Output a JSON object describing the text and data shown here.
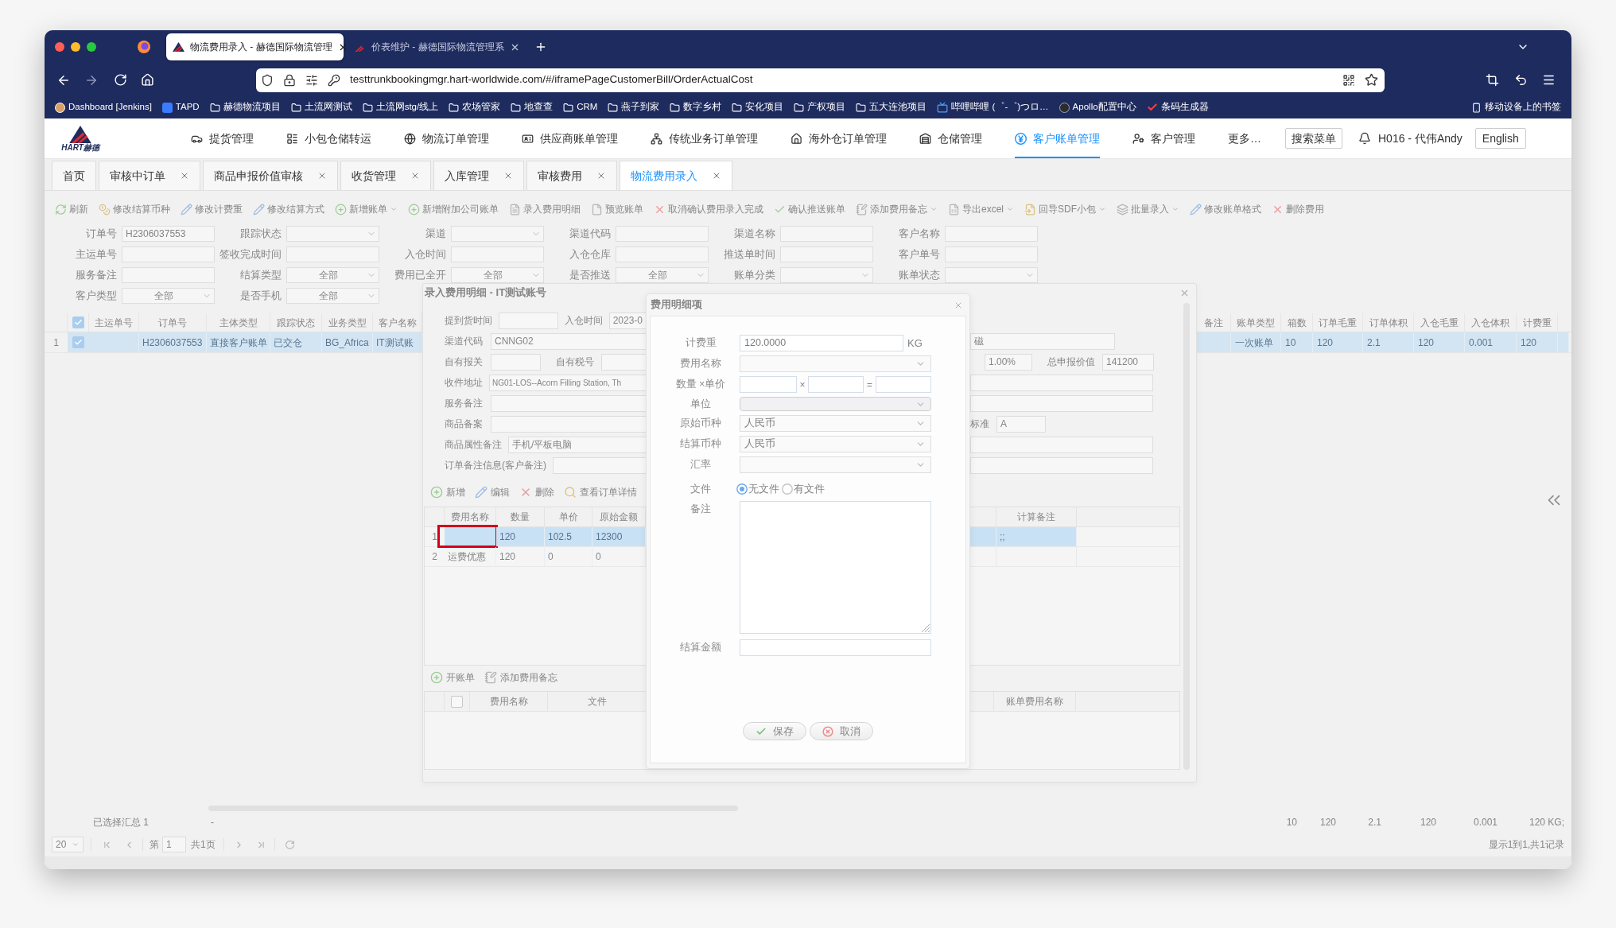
{
  "browser": {
    "tabs": [
      {
        "title": "物流费用录入 - 赫德国际物流管理",
        "selected": true
      },
      {
        "title": "价表维护 - 赫德国际物流管理系",
        "selected": false
      }
    ],
    "url": "testtrunkbookingmgr.hart-worldwide.com/#/iframePageCustomerBill/OrderActualCost",
    "bookmarks": [
      {
        "label": "Dashboard [Jenkins]",
        "kind": "site"
      },
      {
        "label": "TAPD",
        "kind": "site"
      },
      {
        "label": "赫德物流项目",
        "kind": "folder"
      },
      {
        "label": "土流网测试",
        "kind": "folder"
      },
      {
        "label": "土流网stg/线上",
        "kind": "folder"
      },
      {
        "label": "农场管家",
        "kind": "folder"
      },
      {
        "label": "地查查",
        "kind": "folder"
      },
      {
        "label": "CRM",
        "kind": "folder"
      },
      {
        "label": "燕子到家",
        "kind": "folder"
      },
      {
        "label": "数字乡村",
        "kind": "folder"
      },
      {
        "label": "安化项目",
        "kind": "folder"
      },
      {
        "label": "产权项目",
        "kind": "folder"
      },
      {
        "label": "五大连池项目",
        "kind": "folder"
      },
      {
        "label": "哔哩哔哩 (゜-゜)つロ…",
        "kind": "site"
      },
      {
        "label": "Apollo配置中心",
        "kind": "site"
      },
      {
        "label": "条码生成器",
        "kind": "site"
      }
    ],
    "mobile_bookmarks": "移动设备上的书签"
  },
  "app": {
    "logo_text": "HART赫德",
    "nav": [
      {
        "label": "提货管理",
        "selected": false
      },
      {
        "label": "小包仓储转运",
        "selected": false
      },
      {
        "label": "物流订单管理",
        "selected": false
      },
      {
        "label": "供应商账单管理",
        "selected": false
      },
      {
        "label": "传统业务订单管理",
        "selected": false
      },
      {
        "label": "海外仓订单管理",
        "selected": false
      },
      {
        "label": "仓储管理",
        "selected": false
      },
      {
        "label": "客户账单管理",
        "selected": true
      },
      {
        "label": "客户管理",
        "selected": false
      }
    ],
    "more": "更多…",
    "search_menu": "搜索菜单",
    "user": "H016 - 代伟Andy",
    "language": "English"
  },
  "page_tabs": [
    {
      "label": "首页",
      "closable": false,
      "selected": false
    },
    {
      "label": "审核中订单",
      "closable": true,
      "selected": false
    },
    {
      "label": "商品申报价值审核",
      "closable": true,
      "selected": false
    },
    {
      "label": "收货管理",
      "closable": true,
      "selected": false
    },
    {
      "label": "入库管理",
      "closable": true,
      "selected": false
    },
    {
      "label": "审核费用",
      "closable": true,
      "selected": false
    },
    {
      "label": "物流费用录入",
      "closable": true,
      "selected": true
    }
  ],
  "toolbar": [
    {
      "label": "刷新",
      "dropdown": false
    },
    {
      "label": "修改结算币种",
      "dropdown": false
    },
    {
      "label": "修改计费重",
      "dropdown": false
    },
    {
      "label": "修改结算方式",
      "dropdown": false
    },
    {
      "label": "新增账单",
      "dropdown": true
    },
    {
      "label": "新增附加公司账单",
      "dropdown": false
    },
    {
      "label": "录入费用明细",
      "dropdown": false
    },
    {
      "label": "预览账单",
      "dropdown": false
    },
    {
      "label": "取消确认费用录入完成",
      "dropdown": false
    },
    {
      "label": "确认推送账单",
      "dropdown": false
    },
    {
      "label": "添加费用备忘",
      "dropdown": true
    },
    {
      "label": "导出excel",
      "dropdown": true
    },
    {
      "label": "回导SDF小包",
      "dropdown": true
    },
    {
      "label": "批量录入",
      "dropdown": true
    },
    {
      "label": "修改账单格式",
      "dropdown": false
    },
    {
      "label": "删除费用",
      "dropdown": false
    }
  ],
  "filters": [
    [
      {
        "label": "订单号",
        "kind": "text",
        "value": "H2306037553"
      },
      {
        "label": "跟踪状态",
        "kind": "select"
      },
      {
        "label": "渠道",
        "kind": "select"
      },
      {
        "label": "渠道代码",
        "kind": "text"
      },
      {
        "label": "渠道名称",
        "kind": "text"
      },
      {
        "label": "客户名称",
        "kind": "text"
      }
    ],
    [
      {
        "label": "主运单号",
        "kind": "text"
      },
      {
        "label": "签收完成时间",
        "kind": "text"
      },
      {
        "label": "入仓时间",
        "kind": "text"
      },
      {
        "label": "入仓仓库",
        "kind": "text"
      },
      {
        "label": "推送单时间",
        "kind": "text"
      },
      {
        "label": "客户单号",
        "kind": "text"
      }
    ],
    [
      {
        "label": "服务备注",
        "kind": "text"
      },
      {
        "label": "结算类型",
        "kind": "select",
        "value": "全部"
      },
      {
        "label": "费用已全开",
        "kind": "select",
        "value": "全部"
      },
      {
        "label": "是否推送",
        "kind": "select",
        "value": "全部"
      },
      {
        "label": "账单分类",
        "kind": "select"
      },
      {
        "label": "账单状态",
        "kind": "select"
      }
    ],
    [
      {
        "label": "客户类型",
        "kind": "select",
        "value": "全部"
      },
      {
        "label": "是否手机",
        "kind": "select",
        "value": "全部"
      }
    ]
  ],
  "grid": {
    "all_checked": true,
    "left_columns": [
      "主运单号",
      "订单号",
      "主体类型",
      "跟踪状态",
      "业务类型",
      "客户名称"
    ],
    "right_columns": [
      "备注",
      "账单类型",
      "箱数",
      "订单毛重",
      "订单体积",
      "入仓毛重",
      "入仓体积",
      "计费重"
    ],
    "rows": [
      {
        "index": "1",
        "checked": true,
        "selected": true,
        "order_no": "H2306037553",
        "entity_type": "直接客户账单",
        "tracking_status": "已交仓",
        "business_type": "BG_Africa",
        "customer_name": "IT测试账",
        "bill_type": "一次账单",
        "boxes": "10",
        "order_gross_weight": "120",
        "order_volume": "2.1",
        "inbound_gross_weight": "120",
        "inbound_volume": "0.001",
        "chargeable_weight": "120"
      }
    ]
  },
  "footer": {
    "summary": "已选择汇总 1",
    "dash": "-",
    "totals": [
      "10",
      "120",
      "2.1",
      "120",
      "0.001",
      "120 KG;"
    ]
  },
  "pagination": {
    "page_size": "20",
    "page_label": "第",
    "page": "1",
    "page_count": "共1页",
    "info": "显示1到1,共1记录"
  },
  "entry_dialog": {
    "title": "录入费用明细 - IT测试账号",
    "pickup_time": {
      "label": "提到货时间"
    },
    "inbound_time": {
      "label": "入仓时间",
      "value": "2023-0"
    },
    "channel_code": {
      "label": "渠道代码",
      "value": "CNNG02"
    },
    "own_customs": {
      "label": "自有报关"
    },
    "own_tax_no": {
      "label": "自有税号"
    },
    "address": {
      "label": "收件地址",
      "value": "NG01-LOS--Acorn Filling Station, Th"
    },
    "service_note": {
      "label": "服务备注"
    },
    "product_record": {
      "label": "商品备案"
    },
    "product_attr_note": {
      "label": "商品属性备注",
      "value": "手机/平板电脑"
    },
    "order_note": {
      "label": "订单备注信息(客户备注)"
    },
    "field_a": {
      "value": "磁"
    },
    "rate": {
      "value": "1.00%"
    },
    "declared_total": {
      "label": "总申报价值",
      "value": "141200"
    },
    "standard": {
      "label": "标准",
      "value": "A"
    },
    "fee_toolbar": [
      "新增",
      "编辑",
      "删除",
      "查看订单详情"
    ],
    "fee_grid": {
      "columns": [
        "费用名称",
        "数量",
        "单价",
        "原始金额"
      ],
      "extra_column": "计算备注",
      "rows": [
        {
          "index": "1",
          "selected": true,
          "marked": true,
          "qty": "120",
          "price": "102.5",
          "amount": "12300",
          "calc_note": ";;"
        },
        {
          "index": "2",
          "selected": false,
          "marked": false,
          "name": "运费优惠",
          "qty": "120",
          "price": "0",
          "amount": "0"
        }
      ]
    },
    "bill_toolbar": [
      "开账单",
      "添加费用备忘"
    ],
    "bill_grid": {
      "all_checked": false,
      "columns": [
        "费用名称",
        "文件"
      ],
      "extra_column": "账单费用名称"
    }
  },
  "fee_dialog": {
    "title": "费用明细项",
    "chargeable_weight": {
      "label": "计费重",
      "value": "120.0000",
      "unit": "KG"
    },
    "fee_name": {
      "label": "费用名称"
    },
    "qty_price": {
      "label": "数量 ×单价",
      "times": "×",
      "equals": "="
    },
    "unit": {
      "label": "单位"
    },
    "original_currency": {
      "label": "原始币种",
      "value": "人民币"
    },
    "settle_currency": {
      "label": "结算币种",
      "value": "人民币"
    },
    "exchange_rate": {
      "label": "汇率"
    },
    "file": {
      "label": "文件",
      "options": [
        {
          "label": "无文件",
          "selected": true
        },
        {
          "label": "有文件",
          "selected": false
        }
      ]
    },
    "remark": {
      "label": "备注"
    },
    "settle_amount": {
      "label": "结算金额"
    },
    "buttons": [
      {
        "label": "保存",
        "kind": "save"
      },
      {
        "label": "取消",
        "kind": "cancel"
      }
    ]
  }
}
